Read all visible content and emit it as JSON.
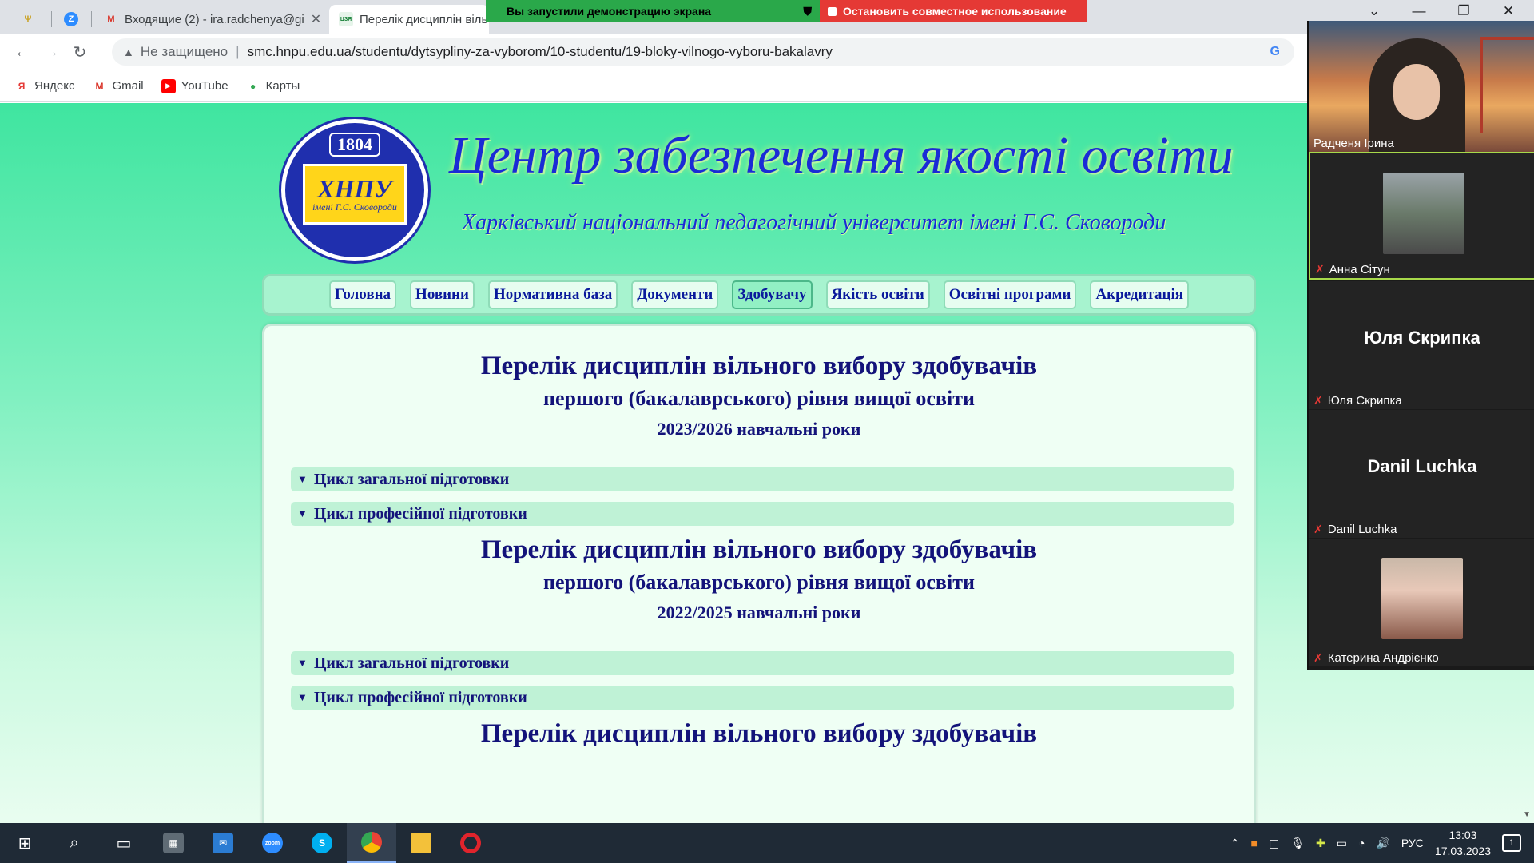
{
  "browser": {
    "tabs": [
      {
        "title": "",
        "favicon": "ua-trident-icon"
      },
      {
        "title": "",
        "favicon": "zoom-icon"
      },
      {
        "title": "Входящие (2) - ira.radchenya@gi",
        "favicon": "gmail-icon"
      },
      {
        "title": "Перелік дисциплін віль",
        "favicon": "cza-icon",
        "favicon_text": "ЦЗЯ",
        "active": true
      }
    ],
    "share_banner": {
      "status": "Вы запустили демонстрацию экрана",
      "stop": "Остановить совместное использование"
    },
    "address": {
      "security": "Не защищено",
      "url": "smc.hnpu.edu.ua/studentu/dytsypliny-za-vyborom/10-studentu/19-bloky-vilnogo-vyboru-bakalavry"
    },
    "bookmarks": [
      {
        "label": "Яндекс",
        "icon": "yandex-icon",
        "glyph": "Я",
        "color": "#e53935"
      },
      {
        "label": "Gmail",
        "icon": "gmail-icon",
        "glyph": "M",
        "color": "#d93025"
      },
      {
        "label": "YouTube",
        "icon": "youtube-icon",
        "glyph": "▶",
        "color": "#ff0000"
      },
      {
        "label": "Карты",
        "icon": "maps-icon",
        "glyph": "●",
        "color": "#34a853"
      }
    ]
  },
  "site": {
    "logo": {
      "year": "1804",
      "abbr": "ХНПУ",
      "sub": "імені Г.С. Сковороди"
    },
    "title": "Центр забезпечення якості освіти",
    "subtitle": "Харківський національний педагогічний університет імені Г.С. Сковороди",
    "menu": [
      "Головна",
      "Новини",
      "Нормативна база",
      "Документи",
      "Здобувачу",
      "Якість освіти",
      "Освітні програми",
      "Акредитація"
    ],
    "current_menu": "Здобувачу",
    "blocks": [
      {
        "title": "Перелік дисциплін вільного вибору здобувачів",
        "level": "першого (бакалаврського) рівня вищої освіти",
        "years": "2023/2026 навчальні роки",
        "sections": [
          "Цикл загальної підготовки",
          "Цикл професійної підготовки"
        ]
      },
      {
        "title": "Перелік дисциплін вільного вибору здобувачів",
        "level": "першого (бакалаврського) рівня вищої освіти",
        "years": "2022/2025 навчальні роки",
        "sections": [
          "Цикл загальної підготовки",
          "Цикл професійної підготовки"
        ]
      }
    ],
    "cut_title": "Перелік дисциплін вільного вибору здобувачів"
  },
  "video": {
    "main_participant": "Радченя Ірина",
    "participants": [
      {
        "name": "Анна Сітун",
        "muted": true,
        "has_photo": true,
        "highlight": true
      },
      {
        "name": "Юля Скрипка",
        "muted": true,
        "has_photo": false
      },
      {
        "name": "Danil Luchka",
        "muted": true,
        "has_photo": false
      },
      {
        "name": "Катерина Андрієнко",
        "muted": true,
        "has_photo": true
      }
    ]
  },
  "taskbar": {
    "apps": [
      "start-icon",
      "search-icon",
      "task-view-icon",
      "calculator-icon",
      "mail-icon",
      "zoom-icon",
      "skype-icon",
      "chrome-icon",
      "file-explorer-icon",
      "opera-icon"
    ],
    "active_app": "chrome-icon",
    "lang": "РУС",
    "time": "13:03",
    "date": "17.03.2023",
    "notifications": "1"
  },
  "colors": {
    "brand_blue": "#1a2bd6",
    "heading_navy": "#13137a",
    "page_green": "#3fe5a0",
    "share_green": "#2aa84a",
    "share_red": "#e53935"
  }
}
